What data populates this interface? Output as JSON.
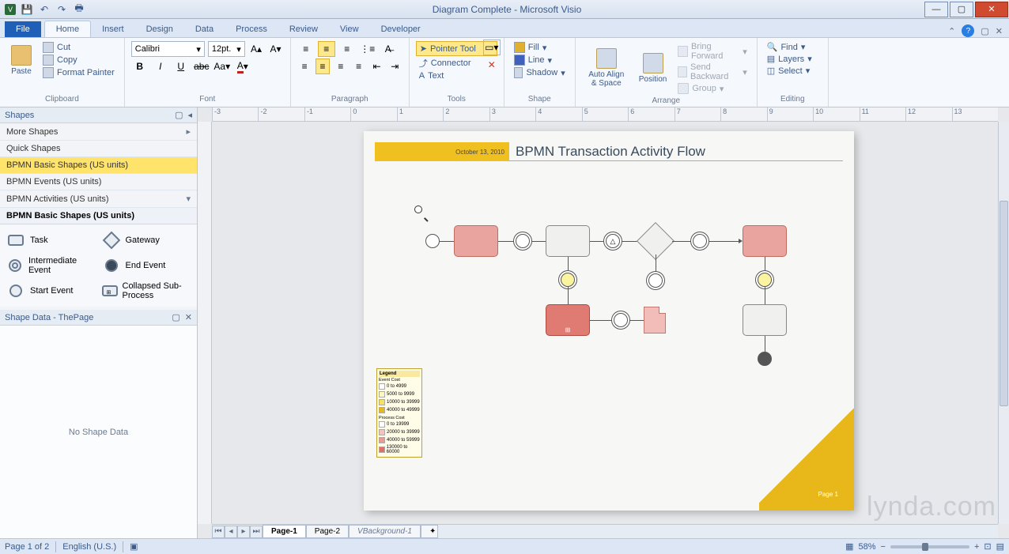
{
  "window": {
    "title": "Diagram Complete - Microsoft Visio"
  },
  "tabs": {
    "file": "File",
    "home": "Home",
    "insert": "Insert",
    "design": "Design",
    "data": "Data",
    "process": "Process",
    "review": "Review",
    "view": "View",
    "developer": "Developer"
  },
  "ribbon": {
    "clipboard": {
      "paste": "Paste",
      "cut": "Cut",
      "copy": "Copy",
      "format_painter": "Format Painter",
      "label": "Clipboard"
    },
    "font": {
      "name": "Calibri",
      "size": "12pt.",
      "label": "Font"
    },
    "paragraph": {
      "label": "Paragraph"
    },
    "tools": {
      "pointer": "Pointer Tool",
      "connector": "Connector",
      "text": "Text",
      "label": "Tools"
    },
    "shape": {
      "fill": "Fill",
      "line": "Line",
      "shadow": "Shadow",
      "label": "Shape"
    },
    "arrange": {
      "auto_align": "Auto Align & Space",
      "position": "Position",
      "bring_forward": "Bring Forward",
      "send_backward": "Send Backward",
      "group": "Group",
      "label": "Arrange"
    },
    "editing": {
      "find": "Find",
      "layers": "Layers",
      "select": "Select",
      "label": "Editing"
    }
  },
  "shapes_panel": {
    "title": "Shapes",
    "more": "More Shapes",
    "quick": "Quick Shapes",
    "basic": "BPMN Basic Shapes (US units)",
    "events": "BPMN Events (US units)",
    "activities": "BPMN Activities (US units)",
    "header": "BPMN Basic Shapes (US units)",
    "task": "Task",
    "gateway": "Gateway",
    "intermediate": "Intermediate Event",
    "end": "End Event",
    "start": "Start Event",
    "collapsed": "Collapsed Sub-Process"
  },
  "shape_data": {
    "title": "Shape Data - ThePage",
    "empty": "No Shape Data"
  },
  "page": {
    "date": "October 13, 2010",
    "title": "BPMN Transaction Activity Flow",
    "footer": "Page 1"
  },
  "legend": {
    "title": "Legend",
    "event_cost": "Event Cost",
    "process_cost": "Process Cost",
    "r1": "0 to 4999",
    "r2": "5000 to 9999",
    "r3": "10000 to 39999",
    "r4": "40000 to 49999",
    "p1": "0 to 19999",
    "p2": "20000 to 39999",
    "p3": "40000 to 59999",
    "p4": "130000 to 60000"
  },
  "pagetabs": {
    "p1": "Page-1",
    "p2": "Page-2",
    "bg": "VBackground-1"
  },
  "status": {
    "page": "Page 1 of 2",
    "lang": "English (U.S.)",
    "zoom": "58%"
  },
  "watermark": "lynda.com"
}
